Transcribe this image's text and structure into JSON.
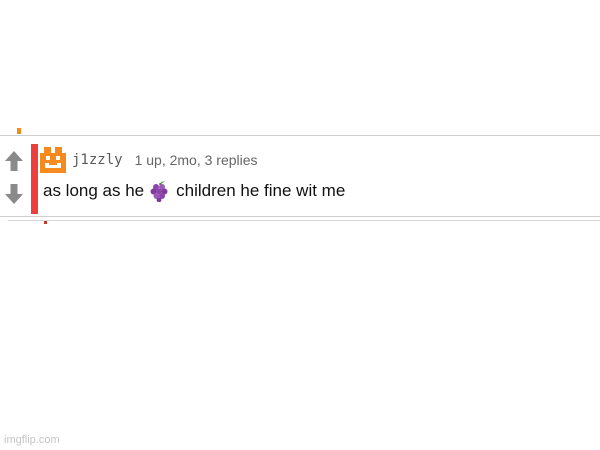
{
  "comment": {
    "username": "j1zzly",
    "stats": "1 up, 2mo, 3 replies",
    "text_before": "as long as he",
    "emoji_icon": "grapes-icon",
    "text_after": "children he fine wit me",
    "upvote_icon": "arrow-up-icon",
    "downvote_icon": "arrow-down-icon",
    "avatar_icon": "pixel-face-avatar-icon"
  },
  "colors": {
    "accent_bar": "#ee3f3f",
    "avatar": "#f58b1f",
    "vote_arrow": "#8a8a8a",
    "username": "#5a5a5a",
    "stats": "#666666",
    "text": "#111111",
    "watermark": "#c4c4c4"
  },
  "watermark": {
    "text": "imgflip.com"
  }
}
